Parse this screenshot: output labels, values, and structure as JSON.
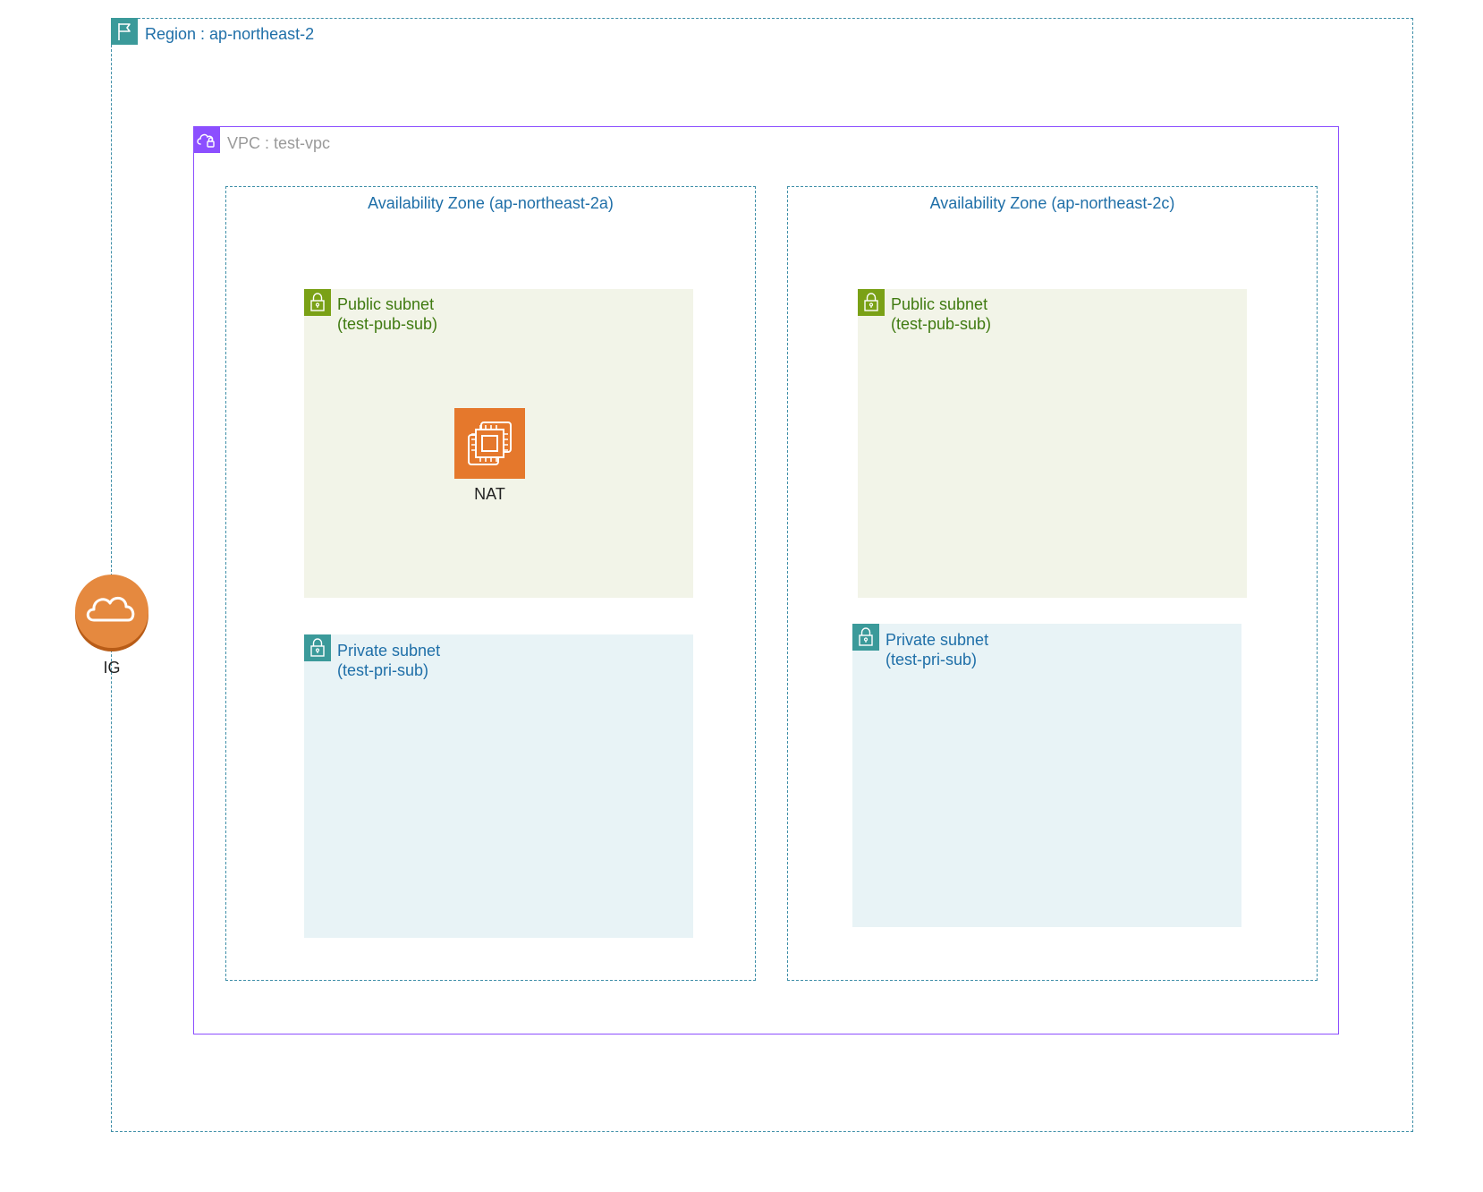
{
  "region": {
    "label": "Region : ap-northeast-2",
    "icon": "flag-icon",
    "color": "#3f8fa8"
  },
  "vpc": {
    "label": "VPC : test-vpc",
    "icon": "vpc-cloud-icon",
    "color": "#8c4fff"
  },
  "availability_zones": [
    {
      "label": "Availability Zone (ap-northeast-2a)",
      "public_subnet": {
        "title": "Public subnet",
        "name": "(test-pub-sub)",
        "icon": "lock-icon",
        "color": "#7aa116"
      },
      "private_subnet": {
        "title": "Private subnet",
        "name": "(test-pri-sub)",
        "icon": "lock-icon",
        "color": "#3b9a9a"
      },
      "nat": {
        "label": "NAT",
        "icon": "ec2-instance-icon",
        "color": "#e5782c"
      }
    },
    {
      "label": "Availability Zone (ap-northeast-2c)",
      "public_subnet": {
        "title": "Public subnet",
        "name": "(test-pub-sub)",
        "icon": "lock-icon",
        "color": "#7aa116"
      },
      "private_subnet": {
        "title": "Private subnet",
        "name": "(test-pri-sub)",
        "icon": "lock-icon",
        "color": "#3b9a9a"
      }
    }
  ],
  "internet_gateway": {
    "label": "IG",
    "icon": "cloud-icon",
    "color": "#e5782c"
  }
}
